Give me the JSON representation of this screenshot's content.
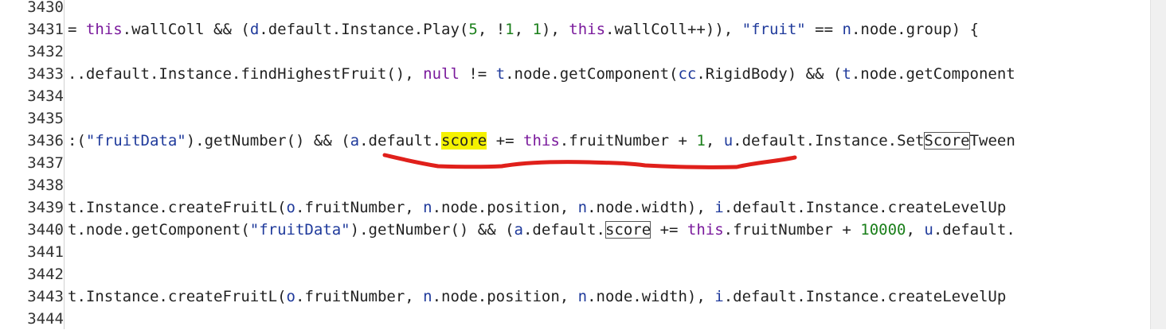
{
  "editor": {
    "line_numbers": [
      "3430",
      "3431",
      "3432",
      "3433",
      "3434",
      "3435",
      "3436",
      "3437",
      "3438",
      "3439",
      "3440",
      "3441",
      "3442",
      "3443",
      "3444"
    ],
    "lines": [
      {
        "tokens": []
      },
      {
        "tokens": [
          {
            "t": "= ",
            "c": "plain"
          },
          {
            "t": "this",
            "c": "kw"
          },
          {
            "t": ".wallColl && (",
            "c": "plain"
          },
          {
            "t": "d",
            "c": "id"
          },
          {
            "t": ".default.Instance.Play(",
            "c": "plain"
          },
          {
            "t": "5",
            "c": "num"
          },
          {
            "t": ", !",
            "c": "plain"
          },
          {
            "t": "1",
            "c": "num"
          },
          {
            "t": ", ",
            "c": "plain"
          },
          {
            "t": "1",
            "c": "num"
          },
          {
            "t": "), ",
            "c": "plain"
          },
          {
            "t": "this",
            "c": "kw"
          },
          {
            "t": ".wallColl++)), ",
            "c": "plain"
          },
          {
            "t": "\"fruit\"",
            "c": "str"
          },
          {
            "t": " == ",
            "c": "plain"
          },
          {
            "t": "n",
            "c": "id"
          },
          {
            "t": ".node.group) {",
            "c": "plain"
          }
        ]
      },
      {
        "tokens": []
      },
      {
        "tokens": [
          {
            "t": "..default.Instance.findHighestFruit(), ",
            "c": "plain"
          },
          {
            "t": "null",
            "c": "kw"
          },
          {
            "t": " != ",
            "c": "plain"
          },
          {
            "t": "t",
            "c": "id"
          },
          {
            "t": ".node.getComponent(",
            "c": "plain"
          },
          {
            "t": "cc",
            "c": "id"
          },
          {
            "t": ".RigidBody) && (",
            "c": "plain"
          },
          {
            "t": "t",
            "c": "id"
          },
          {
            "t": ".node.getComponent",
            "c": "plain"
          }
        ]
      },
      {
        "tokens": []
      },
      {
        "tokens": []
      },
      {
        "tokens": [
          {
            "t": ":(",
            "c": "plain"
          },
          {
            "t": "\"fruitData\"",
            "c": "str"
          },
          {
            "t": ").getNumber() && (",
            "c": "plain"
          },
          {
            "t": "a",
            "c": "id"
          },
          {
            "t": ".default.",
            "c": "plain"
          },
          {
            "t": "score",
            "c": "plain",
            "hl": "yellow"
          },
          {
            "t": " += ",
            "c": "plain"
          },
          {
            "t": "this",
            "c": "kw"
          },
          {
            "t": ".fruitNumber + ",
            "c": "plain"
          },
          {
            "t": "1",
            "c": "num"
          },
          {
            "t": ", ",
            "c": "plain"
          },
          {
            "t": "u",
            "c": "id"
          },
          {
            "t": ".default.Instance.Set",
            "c": "plain"
          },
          {
            "t": "Score",
            "c": "plain",
            "hl": "box"
          },
          {
            "t": "Tween",
            "c": "plain"
          }
        ]
      },
      {
        "tokens": []
      },
      {
        "tokens": []
      },
      {
        "tokens": [
          {
            "t": "t.Instance.createFruitL(",
            "c": "plain"
          },
          {
            "t": "o",
            "c": "id"
          },
          {
            "t": ".fruitNumber, ",
            "c": "plain"
          },
          {
            "t": "n",
            "c": "id"
          },
          {
            "t": ".node.position, ",
            "c": "plain"
          },
          {
            "t": "n",
            "c": "id"
          },
          {
            "t": ".node.width), ",
            "c": "plain"
          },
          {
            "t": "i",
            "c": "id"
          },
          {
            "t": ".default.Instance.createLevelUp",
            "c": "plain"
          }
        ]
      },
      {
        "tokens": [
          {
            "t": "t.node.getComponent(",
            "c": "plain"
          },
          {
            "t": "\"fruitData\"",
            "c": "str"
          },
          {
            "t": ").getNumber() && (",
            "c": "plain"
          },
          {
            "t": "a",
            "c": "id"
          },
          {
            "t": ".default.",
            "c": "plain"
          },
          {
            "t": "score",
            "c": "plain",
            "hl": "box"
          },
          {
            "t": " += ",
            "c": "plain"
          },
          {
            "t": "this",
            "c": "kw"
          },
          {
            "t": ".fruitNumber + ",
            "c": "plain"
          },
          {
            "t": "10000",
            "c": "num"
          },
          {
            "t": ", ",
            "c": "plain"
          },
          {
            "t": "u",
            "c": "id"
          },
          {
            "t": ".default.",
            "c": "plain"
          }
        ]
      },
      {
        "tokens": []
      },
      {
        "tokens": []
      },
      {
        "tokens": [
          {
            "t": "t.Instance.createFruitL(",
            "c": "plain"
          },
          {
            "t": "o",
            "c": "id"
          },
          {
            "t": ".fruitNumber, ",
            "c": "plain"
          },
          {
            "t": "n",
            "c": "id"
          },
          {
            "t": ".node.position, ",
            "c": "plain"
          },
          {
            "t": "n",
            "c": "id"
          },
          {
            "t": ".node.width), ",
            "c": "plain"
          },
          {
            "t": "i",
            "c": "id"
          },
          {
            "t": ".default.Instance.createLevelUp",
            "c": "plain"
          }
        ]
      },
      {
        "tokens": []
      }
    ]
  },
  "annotation": {
    "color": "#e0201b"
  },
  "colors": {
    "keyword": "#7a1a9c",
    "identifier": "#1f3a9b",
    "string": "#1f3a9b",
    "number": "#1a7f1a",
    "highlight": "#f5f200"
  }
}
